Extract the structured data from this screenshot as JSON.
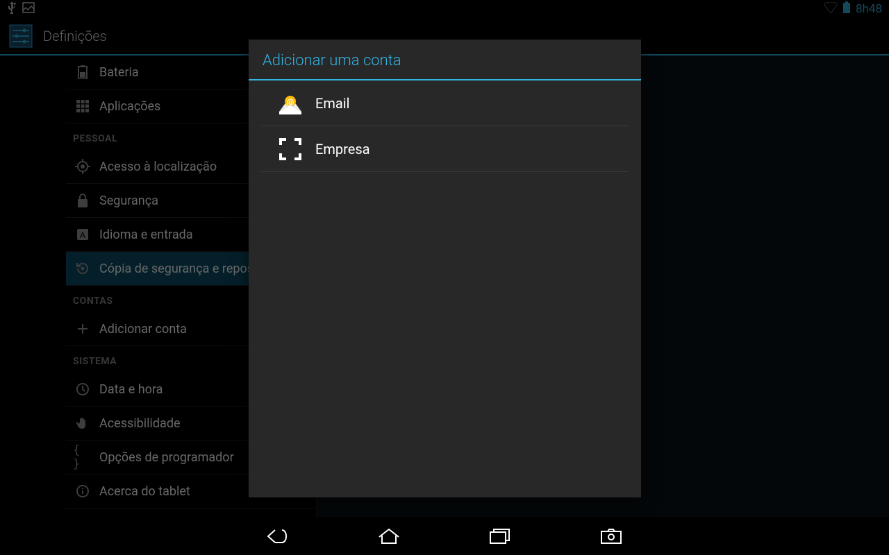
{
  "statusbar": {
    "time": "8h48"
  },
  "action_bar": {
    "title": "Definições"
  },
  "sidebar": [
    {
      "type": "item",
      "icon": "battery",
      "label": "Bateria"
    },
    {
      "type": "item",
      "icon": "apps",
      "label": "Aplicações"
    },
    {
      "type": "header",
      "label": "PESSOAL"
    },
    {
      "type": "item",
      "icon": "location",
      "label": "Acesso à localização"
    },
    {
      "type": "item",
      "icon": "lock",
      "label": "Segurança"
    },
    {
      "type": "item",
      "icon": "language",
      "label": "Idioma e entrada"
    },
    {
      "type": "item",
      "icon": "restore",
      "label": "Cópia de segurança e reposição",
      "selected": true
    },
    {
      "type": "header",
      "label": "CONTAS"
    },
    {
      "type": "item",
      "icon": "add",
      "label": "Adicionar conta"
    },
    {
      "type": "header",
      "label": "SISTEMA"
    },
    {
      "type": "item",
      "icon": "clock",
      "label": "Data e hora"
    },
    {
      "type": "item",
      "icon": "hand",
      "label": "Acessibilidade"
    },
    {
      "type": "item",
      "icon": "braces",
      "label": "Opções de programador"
    },
    {
      "type": "item",
      "icon": "info",
      "label": "Acerca do tablet"
    }
  ],
  "dialog": {
    "title": "Adicionar uma conta",
    "items": [
      {
        "icon": "email",
        "label": "Email"
      },
      {
        "icon": "corporate",
        "label": "Empresa"
      }
    ]
  }
}
